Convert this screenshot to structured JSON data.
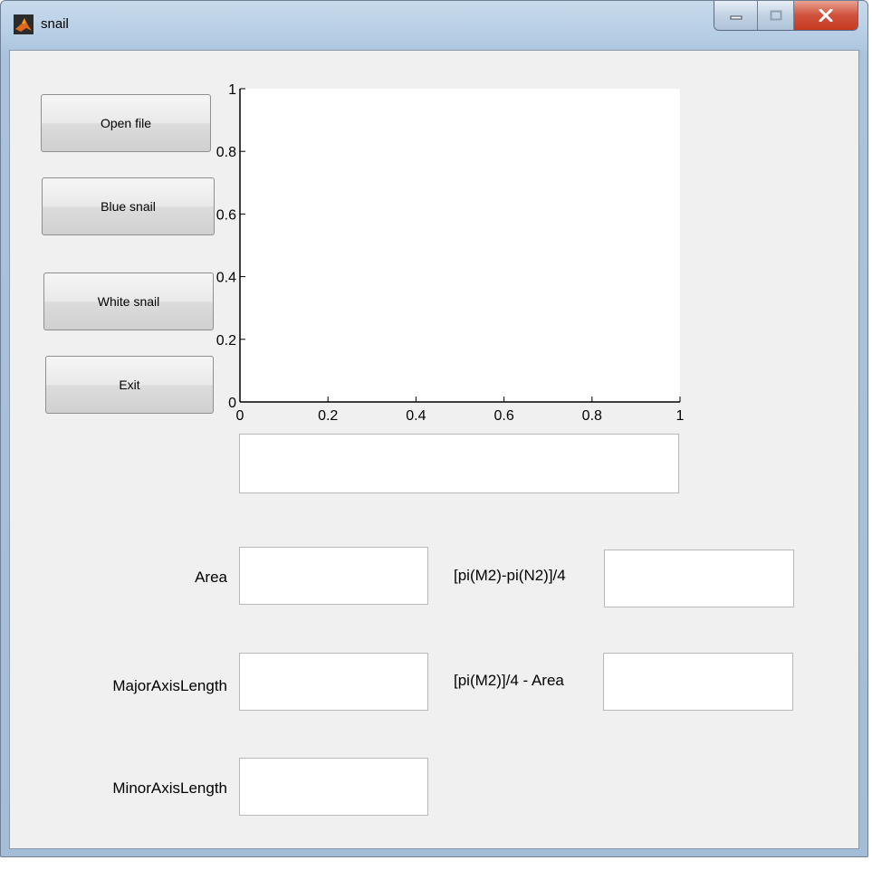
{
  "window": {
    "title": "snail",
    "icon": "matlab-icon"
  },
  "buttons": {
    "open_file": "Open file",
    "blue_snail": "Blue snail",
    "white_snail": "White snail",
    "exit": "Exit"
  },
  "axes": {
    "x_ticks": [
      "0",
      "0.2",
      "0.4",
      "0.6",
      "0.8",
      "1"
    ],
    "y_ticks": [
      "0",
      "0.2",
      "0.4",
      "0.6",
      "0.8",
      "1"
    ],
    "xlim": [
      0,
      1
    ],
    "ylim": [
      0,
      1
    ]
  },
  "fields": {
    "area_label": "Area",
    "area_value": "",
    "major_label": "MajorAxisLength",
    "major_value": "",
    "minor_label": "MinorAxisLength",
    "minor_value": "",
    "formula1_label": "[pi(M2)-pi(N2)]/4",
    "formula1_value": "",
    "formula2_label": "[pi(M2)]/4 - Area",
    "formula2_value": "",
    "result_value": ""
  }
}
